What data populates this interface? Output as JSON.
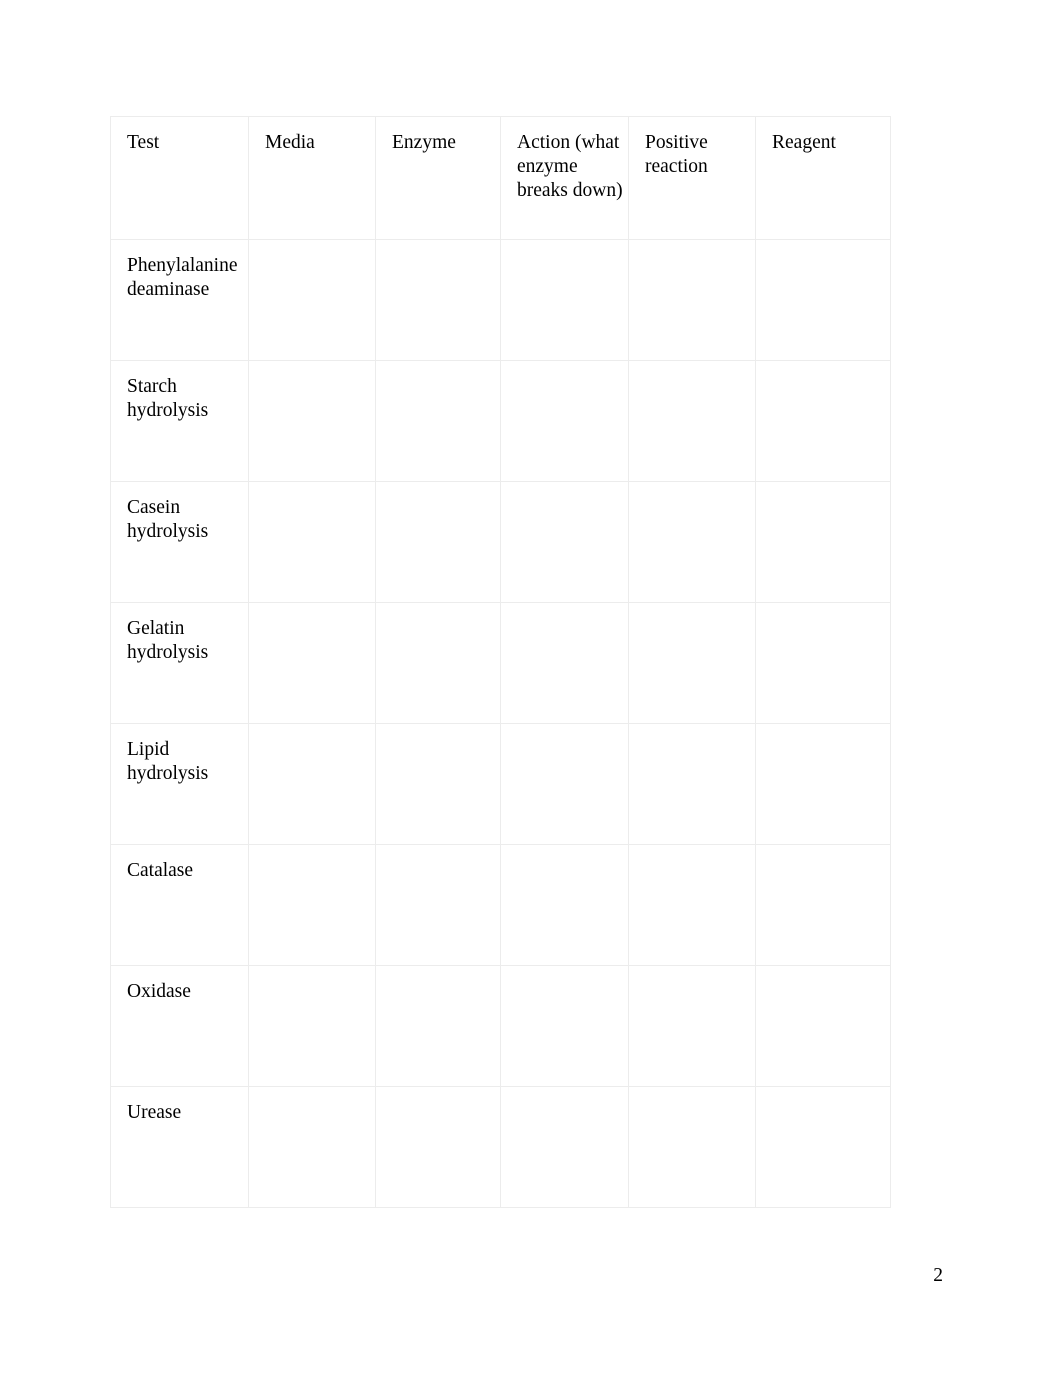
{
  "document": {
    "page_number": "2",
    "table": {
      "columns": [
        {
          "key": "test",
          "header": "Test"
        },
        {
          "key": "media",
          "header": "Media"
        },
        {
          "key": "enzyme",
          "header": "Enzyme"
        },
        {
          "key": "action",
          "header": "Action (what enzyme breaks down)"
        },
        {
          "key": "positive",
          "header": "Positive reaction"
        },
        {
          "key": "reagent",
          "header": "Reagent"
        }
      ],
      "rows": [
        {
          "test": "Phenylalanine deaminase",
          "media": "",
          "enzyme": "",
          "action": "",
          "positive": "",
          "reagent": ""
        },
        {
          "test": "Starch hydrolysis",
          "media": "",
          "enzyme": "",
          "action": "",
          "positive": "",
          "reagent": ""
        },
        {
          "test": "Casein hydrolysis",
          "media": "",
          "enzyme": "",
          "action": "",
          "positive": "",
          "reagent": ""
        },
        {
          "test": "Gelatin hydrolysis",
          "media": "",
          "enzyme": "",
          "action": "",
          "positive": "",
          "reagent": ""
        },
        {
          "test": "Lipid hydrolysis",
          "media": "",
          "enzyme": "",
          "action": "",
          "positive": "",
          "reagent": ""
        },
        {
          "test": "Catalase",
          "media": "",
          "enzyme": "",
          "action": "",
          "positive": "",
          "reagent": ""
        },
        {
          "test": "Oxidase",
          "media": "",
          "enzyme": "",
          "action": "",
          "positive": "",
          "reagent": ""
        },
        {
          "test": "Urease",
          "media": "",
          "enzyme": "",
          "action": "",
          "positive": "",
          "reagent": ""
        }
      ]
    }
  }
}
